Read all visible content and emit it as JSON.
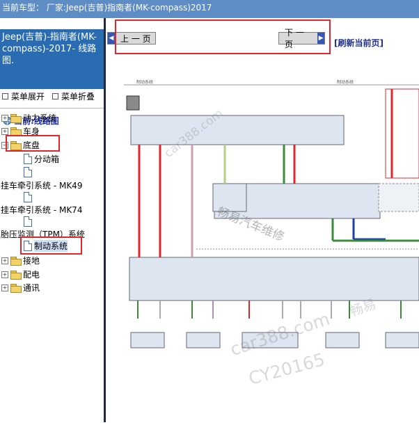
{
  "topbar": {
    "title": "当前车型：  厂家:Jeep(吉普)指南者(MK-compass)2017"
  },
  "sidebar": {
    "heading": "Jeep(吉普)-指南者(MK-compass)-2017- 线路图.",
    "expand_all": "菜单展开",
    "collapse_all": "菜单折叠",
    "root": "当前:线路图",
    "items": [
      {
        "label": "动力系统",
        "type": "folder"
      },
      {
        "label": "车身",
        "type": "folder"
      },
      {
        "label": "底盘",
        "type": "folder",
        "open": true
      },
      {
        "label": "分动箱",
        "type": "doc"
      },
      {
        "label": "",
        "type": "doc"
      },
      {
        "label": "挂车牵引系统 - MK49",
        "type": "text"
      },
      {
        "label": "",
        "type": "doc"
      },
      {
        "label": "挂车牵引系统 - MK74",
        "type": "text"
      },
      {
        "label": "",
        "type": "doc"
      },
      {
        "label": "胎压监测（TPM）系统",
        "type": "text"
      },
      {
        "label": "制动系统",
        "type": "doc",
        "selected": true
      },
      {
        "label": "接地",
        "type": "folder"
      },
      {
        "label": "配电",
        "type": "folder"
      },
      {
        "label": "通讯",
        "type": "folder"
      }
    ]
  },
  "viewer": {
    "prev": "上 一 页",
    "next": "下 一 页",
    "refresh": "[刷新当前页]",
    "diagram_title_left": "制动系统",
    "diagram_title_right": "制动系统"
  },
  "watermarks": {
    "w1": "car388.com",
    "w2": "畅易汽车维修",
    "w3": "畅易",
    "w4": "car388.com",
    "w5": "CY20165"
  },
  "colors": {
    "topbar": "#5e8cc4",
    "heading": "#2a6cb2",
    "highlight": "#e0252d"
  }
}
